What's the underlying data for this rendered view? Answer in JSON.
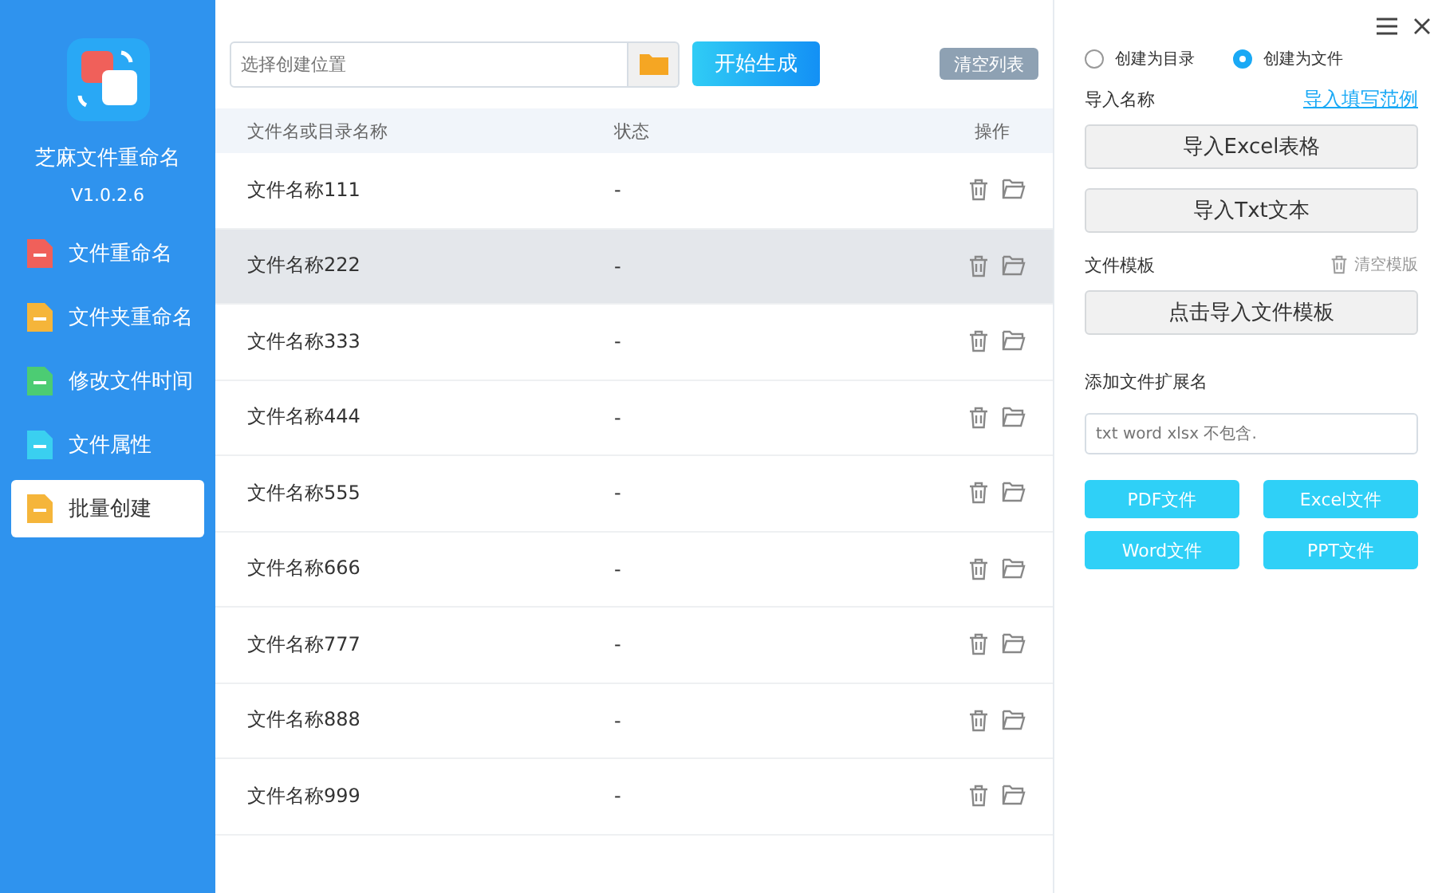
{
  "app": {
    "name": "芝麻文件重命名",
    "version": "V1.0.2.6"
  },
  "sidebar": {
    "items": [
      {
        "label": "文件重命名",
        "color": "#f0605a",
        "selected": false
      },
      {
        "label": "文件夹重命名",
        "color": "#f5b53a",
        "selected": false
      },
      {
        "label": "修改文件时间",
        "color": "#4ccc73",
        "selected": false
      },
      {
        "label": "文件属性",
        "color": "#3ad0f0",
        "selected": false
      },
      {
        "label": "批量创建",
        "color": "#f5b53a",
        "selected": true
      }
    ]
  },
  "toolbar": {
    "location": {
      "placeholder": "选择创建位置"
    },
    "start_button": "开始生成",
    "clear_button": "清空列表"
  },
  "table": {
    "columns": [
      "文件名或目录名称",
      "状态",
      "操作"
    ],
    "rows": [
      {
        "name": "文件名称111",
        "status": "-",
        "selected": false
      },
      {
        "name": "文件名称222",
        "status": "-",
        "selected": true
      },
      {
        "name": "文件名称333",
        "status": "-",
        "selected": false
      },
      {
        "name": "文件名称444",
        "status": "-",
        "selected": false
      },
      {
        "name": "文件名称555",
        "status": "-",
        "selected": false
      },
      {
        "name": "文件名称666",
        "status": "-",
        "selected": false
      },
      {
        "name": "文件名称777",
        "status": "-",
        "selected": false
      },
      {
        "name": "文件名称888",
        "status": "-",
        "selected": false
      },
      {
        "name": "文件名称999",
        "status": "-",
        "selected": false
      }
    ]
  },
  "panel": {
    "modes": [
      {
        "label": "创建为目录",
        "selected": false
      },
      {
        "label": "创建为文件",
        "selected": true
      }
    ],
    "import_label": "导入名称",
    "example_link": "导入填写范例",
    "import_buttons": [
      "导入Excel表格",
      "导入Txt文本"
    ],
    "template_label": "文件模板",
    "clear_template": "清空模版",
    "template_button": "点击导入文件模板",
    "extension_label": "添加文件扩展名",
    "extension": {
      "placeholder": "txt word xlsx 不包含."
    },
    "type_buttons": [
      "PDF文件",
      "Excel文件",
      "Word文件",
      "PPT文件"
    ]
  }
}
